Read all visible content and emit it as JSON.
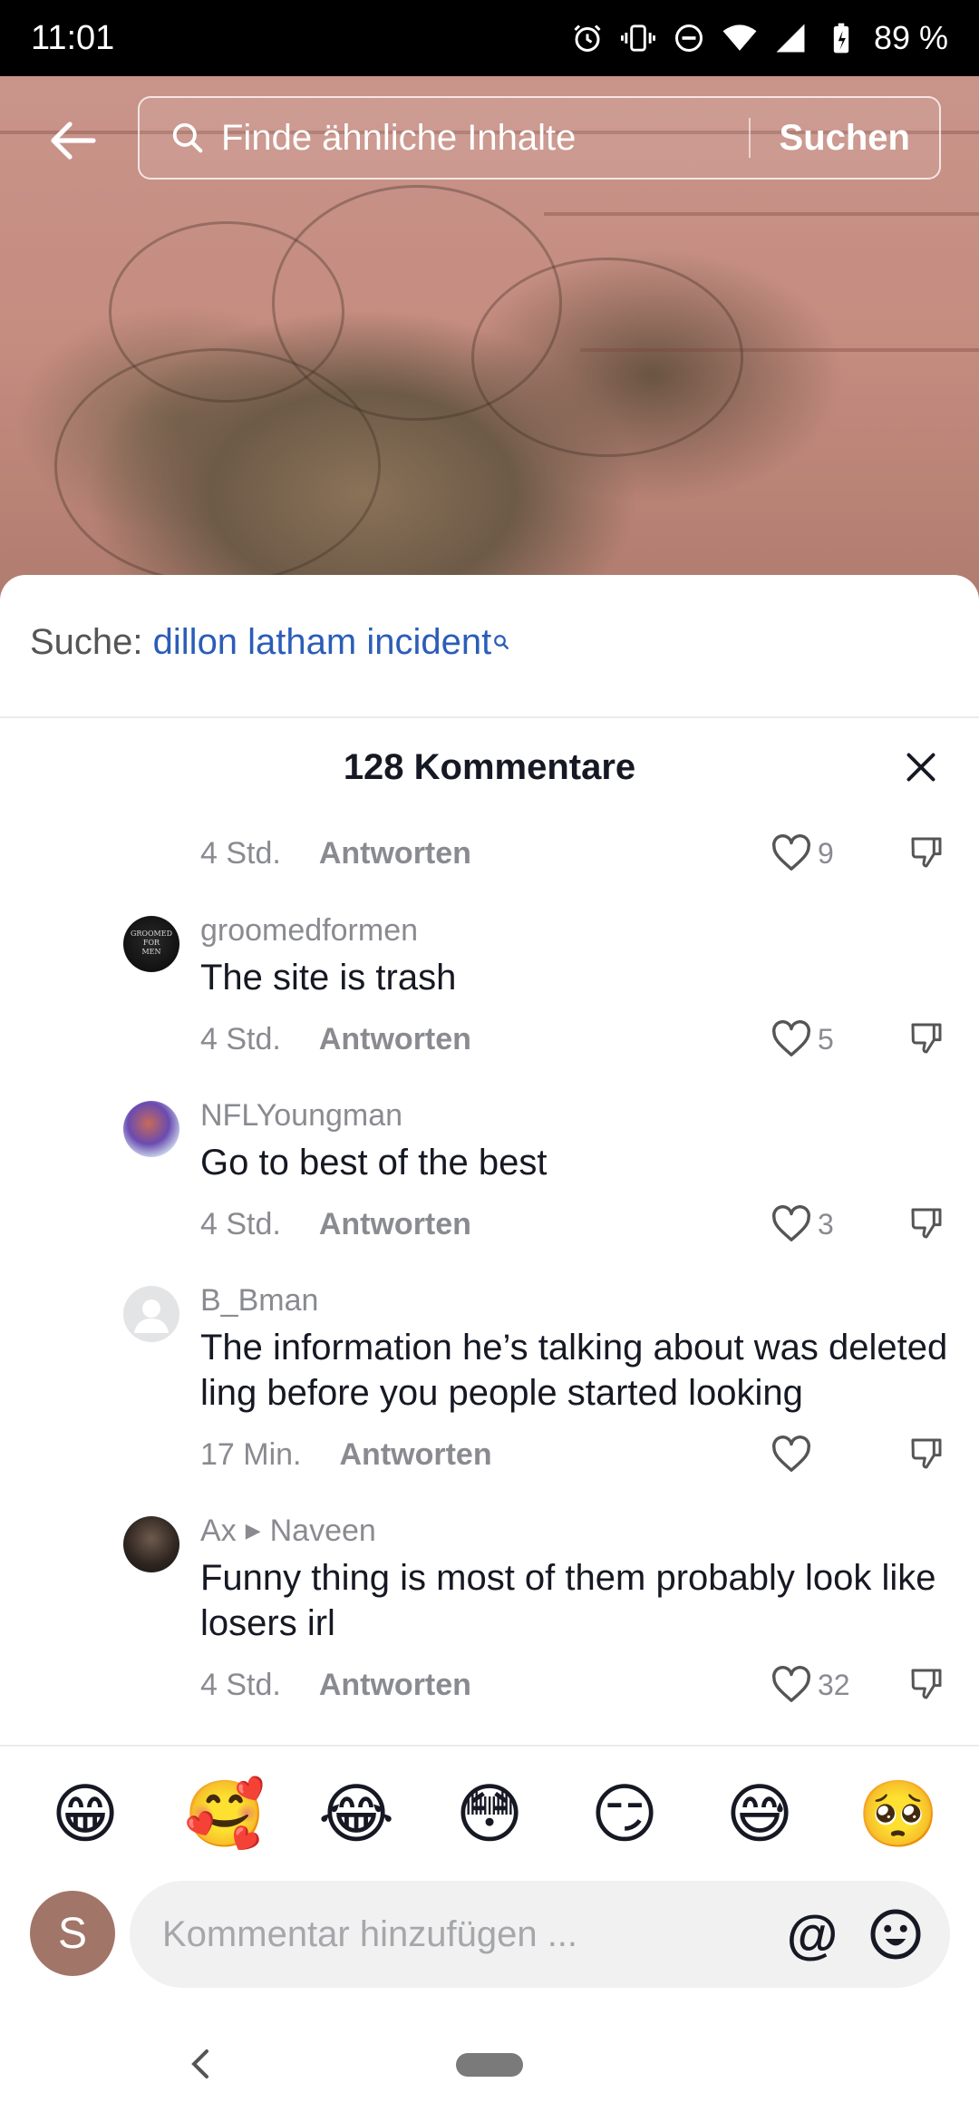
{
  "status_bar": {
    "time": "11:01",
    "battery": "89 %",
    "icons": [
      "alarm-icon",
      "vibrate-icon",
      "do-not-disturb-icon",
      "wifi-icon",
      "signal-icon",
      "battery-icon"
    ]
  },
  "header": {
    "search_placeholder": "Finde ähnliche Inhalte",
    "search_button": "Suchen"
  },
  "suggestion": {
    "prefix": "Suche:",
    "term": "dillon latham incident"
  },
  "comments_header": {
    "title": "128 Kommentare"
  },
  "comments": [
    {
      "time": "4 Std.",
      "reply": "Antworten",
      "likes": "9"
    },
    {
      "user": "groomedformen",
      "text": "The site is trash",
      "time": "4 Std.",
      "reply": "Antworten",
      "likes": "5"
    },
    {
      "user": "NFLYoungman",
      "text": "Go to best of the best",
      "time": "4 Std.",
      "reply": "Antworten",
      "likes": "3"
    },
    {
      "user": "B_Bman",
      "text": "The information he’s talking about was deleted ling before you people started looking",
      "time": "17 Min.",
      "reply": "Antworten",
      "likes": ""
    },
    {
      "user": "Ax",
      "reply_to": "Naveen",
      "text": "Funny thing is most of them probably look like losers irl",
      "time": "4 Std.",
      "reply": "Antworten",
      "likes": "32"
    }
  ],
  "emojis": [
    "😁",
    "🥰",
    "😂",
    "😳",
    "😏",
    "😅",
    "🥺"
  ],
  "composer": {
    "avatar_letter": "S",
    "placeholder": "Kommentar hinzufügen ..."
  },
  "colors": {
    "link_blue": "#2b5db8",
    "muted_gray": "#8a8b91",
    "avatar_brown": "#a27569"
  }
}
